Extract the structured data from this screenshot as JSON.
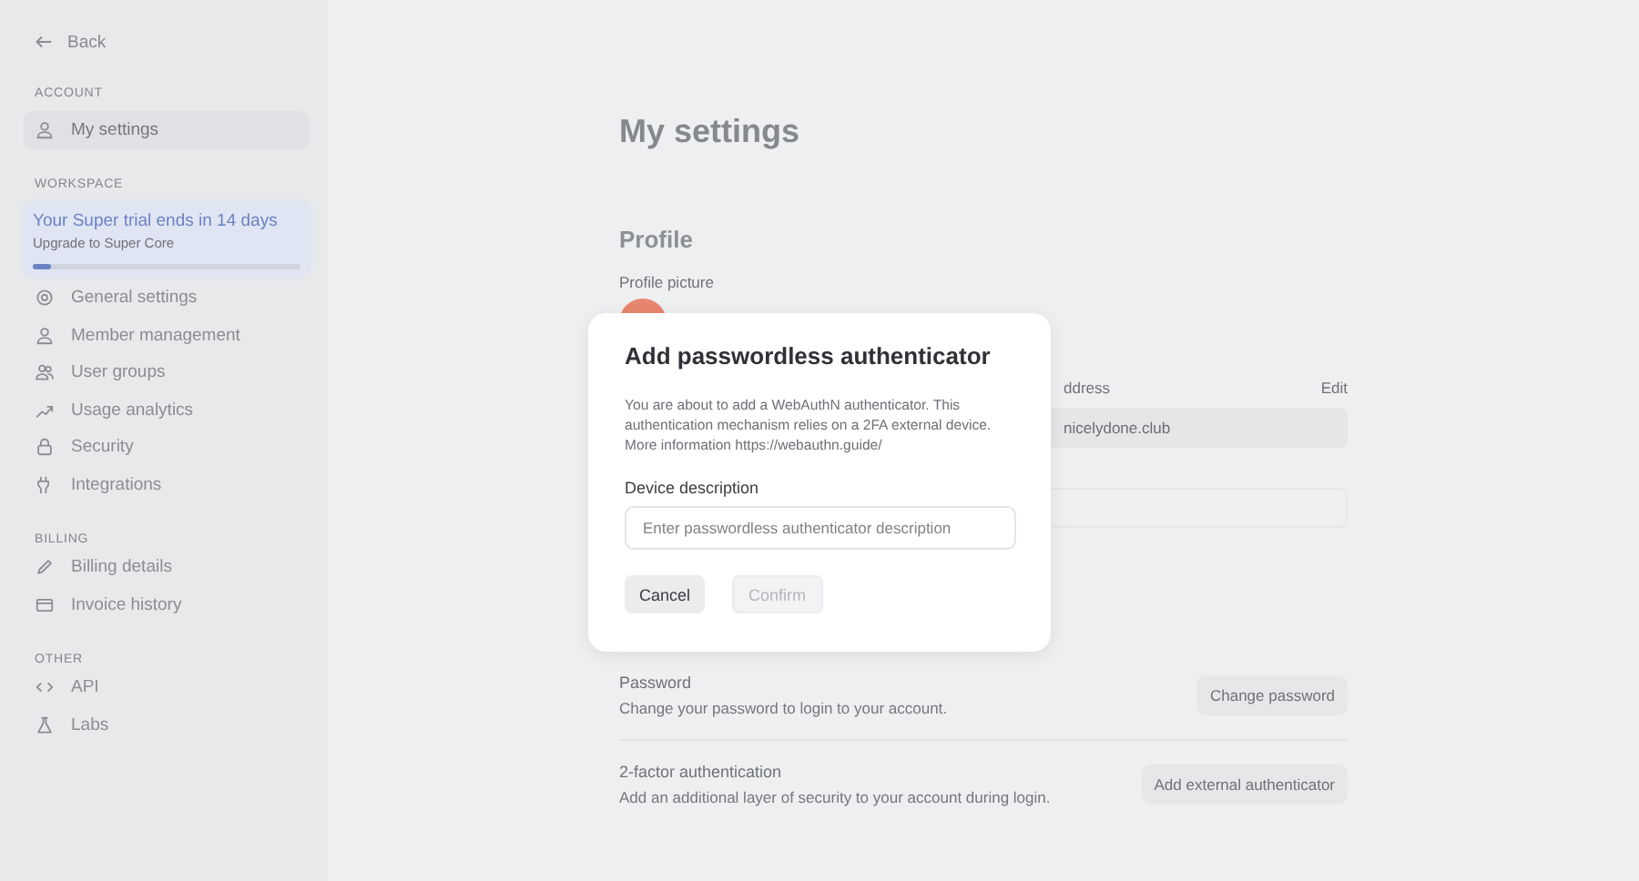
{
  "sidebar": {
    "back": "Back",
    "sections": [
      {
        "heading": "ACCOUNT",
        "items": [
          {
            "label": "My settings",
            "selected": true
          }
        ]
      },
      {
        "heading": "WORKSPACE",
        "trial": {
          "title": "Your Super trial ends in 14 days",
          "subtitle": "Upgrade to Super Core",
          "level": 0.07
        },
        "items": [
          {
            "label": "General settings",
            "selected": false
          },
          {
            "label": "Member management",
            "selected": false
          },
          {
            "label": "User groups",
            "selected": false
          },
          {
            "label": "Usage analytics",
            "selected": false
          },
          {
            "label": "Security",
            "selected": false
          },
          {
            "label": "Integrations",
            "selected": false
          }
        ]
      },
      {
        "heading": "BILLING",
        "items": [
          {
            "label": "Billing details",
            "selected": false
          },
          {
            "label": "Invoice history",
            "selected": false
          }
        ]
      },
      {
        "heading": "OTHER",
        "items": [
          {
            "label": "API",
            "selected": false
          },
          {
            "label": "Labs",
            "selected": false
          }
        ]
      }
    ]
  },
  "main": {
    "title": "My settings",
    "profile": {
      "heading": "Profile",
      "picture_label": "Profile picture",
      "email_label": "ddress",
      "edit": "Edit",
      "email_value": "nicelydone.club"
    },
    "security": [
      {
        "title": "Password",
        "description": "Change your password to login to your account.",
        "button": "Change password"
      },
      {
        "title": "2-factor authentication",
        "description": "Add an additional layer of security to your account during login.",
        "button": "Add external authenticator"
      }
    ]
  },
  "dialog": {
    "title": "Add passwordless authenticator",
    "text": "You are about to add a WebAuthN authenticator. This authentication mechanism relies on a 2FA external device. More information https://webauthn.guide/",
    "field_label": "Device description",
    "placeholder": "Enter passwordless authenticator description",
    "buttons": [
      {
        "label": "Cancel",
        "disabled": false
      },
      {
        "label": "Confirm",
        "disabled": true
      }
    ]
  }
}
